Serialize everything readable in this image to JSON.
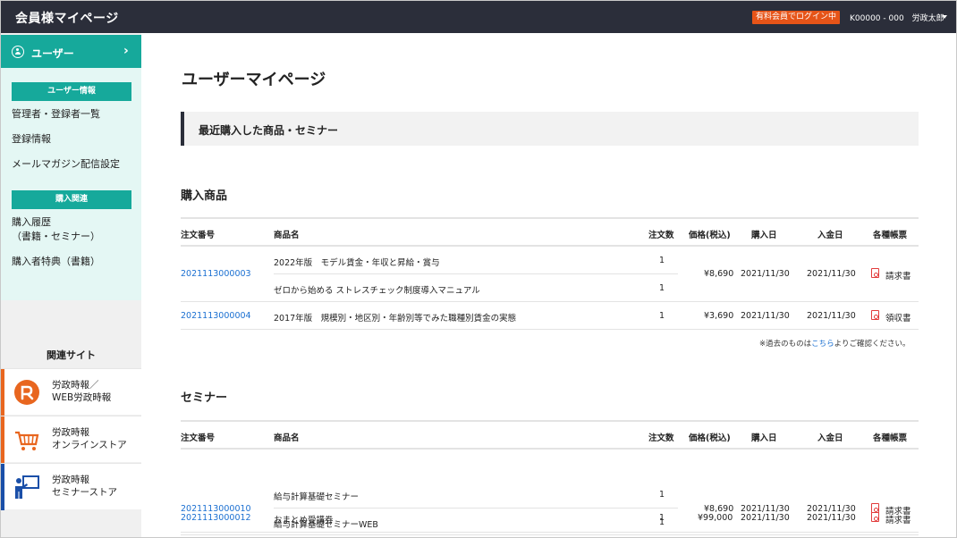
{
  "header": {
    "app_title": "会員様マイページ",
    "badge": "有料会員でログイン中",
    "user_info": "K00000 - 000　労政太郎"
  },
  "sidebar": {
    "head_label": "ユーザー",
    "section1": "ユーザー情報",
    "links1": [
      "管理者・登録者一覧",
      "登録情報",
      "メールマガジン配信設定"
    ],
    "section2": "購入関連",
    "links2": [
      "購入履歴",
      "（書籍・セミナー）",
      "購入者特典（書籍）"
    ],
    "related_title": "関連サイト",
    "sites": [
      {
        "line1": "労政時報／",
        "line2": "WEB労政時報",
        "color": "#e8661f"
      },
      {
        "line1": "労政時報",
        "line2": "オンラインストア",
        "color": "#e8661f"
      },
      {
        "line1": "労政時報",
        "line2": "セミナーストア",
        "color": "#1a4fa8"
      }
    ]
  },
  "main": {
    "page_title": "ユーザーマイページ",
    "banner": "最近購入した商品・セミナー",
    "products_title": "購入商品",
    "seminars_title": "セミナー",
    "columns": [
      "注文番号",
      "商品名",
      "注文数",
      "価格(税込)",
      "購入日",
      "入金日",
      "各種帳票"
    ],
    "products": [
      {
        "order": "2021113000003",
        "items": [
          [
            "2022年版　モデル賃金・年収と昇給・賞与",
            "1"
          ],
          [
            "ゼロから始める ストレスチェック制度導入マニュアル",
            "1"
          ]
        ],
        "price": "¥8,690",
        "purchase": "2021/11/30",
        "payment": "2021/11/30",
        "doc": "請求書"
      },
      {
        "order": "2021113000004",
        "items": [
          [
            "2017年版　規模別・地区別・年齢別等でみた職種別賃金の実態",
            "1"
          ]
        ],
        "price": "¥3,690",
        "purchase": "2021/11/30",
        "payment": "2021/11/30",
        "doc": "領収書"
      }
    ],
    "note_prefix": "※過去のものは",
    "note_link": "こちら",
    "note_suffix": "よりご確認ください。",
    "seminars": [
      {
        "order": "2021113000010",
        "items": [
          [
            "給与計算基礎セミナー",
            "1"
          ],
          [
            "給与計算基礎セミナーWEB",
            "1"
          ]
        ],
        "price": "¥8,690",
        "purchase": "2021/11/30",
        "payment": "2021/11/30",
        "doc": "請求書"
      },
      {
        "order": "2021113000012",
        "items": [
          [
            "おまとめ受講券",
            "1"
          ]
        ],
        "price": "¥99,000",
        "purchase": "2021/11/30",
        "payment": "2021/11/30",
        "doc": "請求書"
      }
    ]
  }
}
